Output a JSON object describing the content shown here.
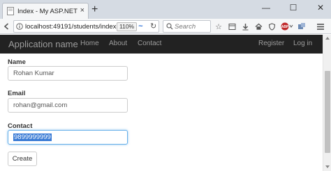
{
  "browser": {
    "tab": {
      "title": "Index - My ASP.NET Applica",
      "close_glyph": "×"
    },
    "new_tab_glyph": "+",
    "window": {
      "minimize": "—",
      "maximize": "☐",
      "close": "✕"
    },
    "url": "localhost:49191/students/index",
    "zoom": "110%",
    "search_placeholder": "Search"
  },
  "app": {
    "brand": "Application name",
    "nav_links": [
      "Home",
      "About",
      "Contact"
    ],
    "right_links": [
      "Register",
      "Log in"
    ]
  },
  "form": {
    "name": {
      "label": "Name",
      "value": "Rohan Kumar"
    },
    "email": {
      "label": "Email",
      "value": "rohan@gmail.com"
    },
    "contact": {
      "label": "Contact",
      "value": "9899999999"
    },
    "submit_label": "Create"
  }
}
